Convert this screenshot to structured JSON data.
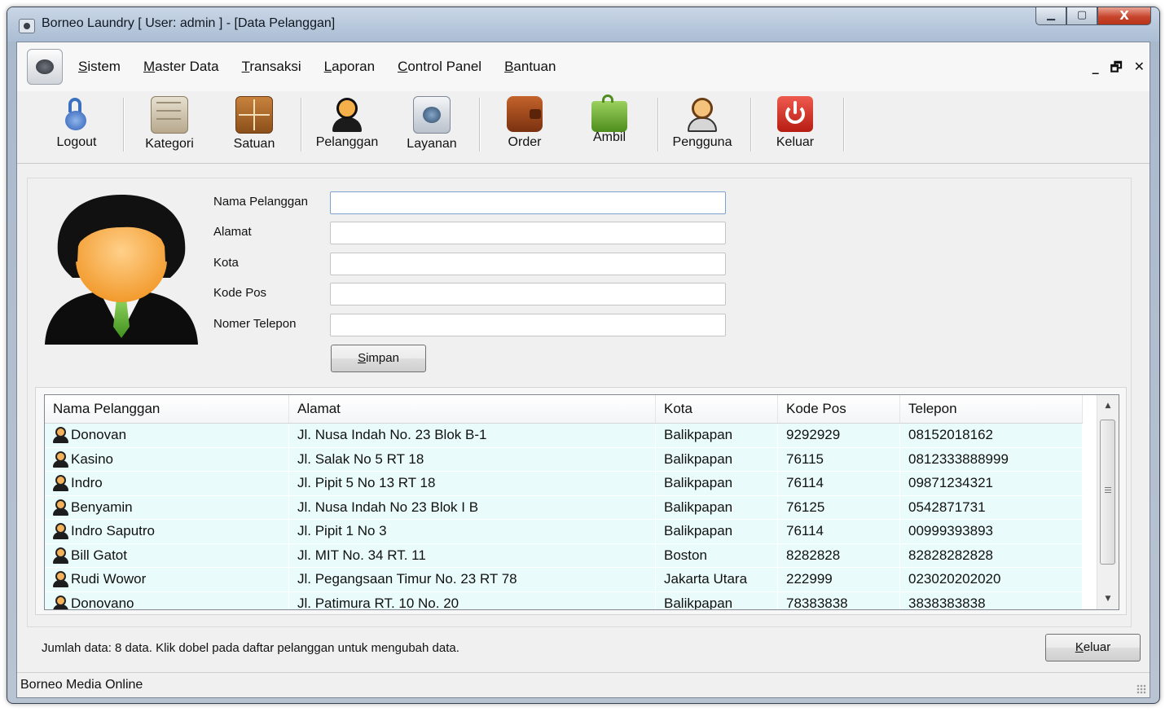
{
  "window": {
    "title": "Borneo Laundry [ User: admin ]  - [Data Pelanggan]",
    "controls": {
      "minimize": "▁",
      "maximize": "▢",
      "close": "X"
    }
  },
  "menu": {
    "items": [
      {
        "first": "S",
        "rest": "istem"
      },
      {
        "first": "M",
        "rest": "aster Data"
      },
      {
        "first": "T",
        "rest": "ransaksi"
      },
      {
        "first": "L",
        "rest": "aporan"
      },
      {
        "first": "C",
        "rest": "ontrol Panel"
      },
      {
        "first": "B",
        "rest": "antuan"
      }
    ],
    "mdi": {
      "minimize": "_",
      "restore": "🗗",
      "close": "✕"
    }
  },
  "toolbar": {
    "items": [
      {
        "label": "Logout",
        "icon": "lock-icon"
      },
      {
        "label": "Kategori",
        "icon": "cabinet-icon"
      },
      {
        "label": "Satuan",
        "icon": "grid-icon"
      },
      {
        "label": "Pelanggan",
        "icon": "customer-icon"
      },
      {
        "label": "Layanan",
        "icon": "washer-icon"
      },
      {
        "label": "Order",
        "icon": "wallet-icon"
      },
      {
        "label": "Ambil",
        "icon": "bag-icon"
      },
      {
        "label": "Pengguna",
        "icon": "user-icon"
      },
      {
        "label": "Keluar",
        "icon": "power-icon"
      }
    ]
  },
  "form": {
    "labels": {
      "nama": "Nama Pelanggan",
      "alamat": "Alamat",
      "kota": "Kota",
      "kode_pos": "Kode Pos",
      "telepon": "Nomer Telepon"
    },
    "values": {
      "nama": "",
      "alamat": "",
      "kota": "",
      "kode_pos": "",
      "telepon": ""
    },
    "save_first": "S",
    "save_rest": "impan"
  },
  "grid": {
    "columns": [
      "Nama Pelanggan",
      "Alamat",
      "Kota",
      "Kode Pos",
      "Telepon"
    ],
    "rows": [
      [
        "Donovan",
        "Jl. Nusa Indah No. 23 Blok B-1",
        "Balikpapan",
        "9292929",
        "08152018162"
      ],
      [
        "Kasino",
        "Jl. Salak No 5 RT 18",
        "Balikpapan",
        "76115",
        "0812333888999"
      ],
      [
        "Indro",
        "Jl. Pipit 5 No 13 RT 18",
        "Balikpapan",
        "76114",
        "09871234321"
      ],
      [
        "Benyamin",
        "Jl. Nusa Indah No 23 Blok I B",
        "Balikpapan",
        "76125",
        "0542871731"
      ],
      [
        "Indro Saputro",
        "Jl. Pipit 1 No 3",
        "Balikpapan",
        "76114",
        "00999393893"
      ],
      [
        "Bill Gatot",
        "Jl. MIT No. 34 RT. 11",
        "Boston",
        "8282828",
        "82828282828"
      ],
      [
        "Rudi Wowor",
        "Jl. Pegangsaan Timur No. 23 RT 78",
        "Jakarta Utara",
        "222999",
        "023020202020"
      ],
      [
        "Donovano",
        "Jl. Patimura RT. 10 No. 20",
        "Balikpapan",
        "78383838",
        "3838383838"
      ]
    ]
  },
  "footer": {
    "info": "Jumlah data:  8 data.  Klik dobel pada daftar pelanggan untuk mengubah data.",
    "close_first": "K",
    "close_rest": "eluar"
  },
  "status": {
    "text": "Borneo Media Online"
  },
  "colors": {
    "row_bg": "#e9fbfb",
    "accent_close": "#c8452d"
  }
}
